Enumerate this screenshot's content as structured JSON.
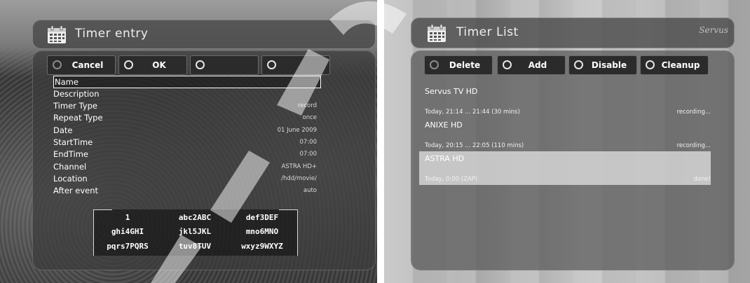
{
  "timer_entry": {
    "title": "Timer entry",
    "buttons": [
      {
        "label": "Cancel"
      },
      {
        "label": "OK"
      },
      {
        "label": ""
      },
      {
        "label": ""
      }
    ],
    "fields": [
      {
        "label": "Name",
        "value": ""
      },
      {
        "label": "Description",
        "value": ""
      },
      {
        "label": "Timer Type",
        "value": "record"
      },
      {
        "label": "Repeat Type",
        "value": "once"
      },
      {
        "label": "Date",
        "value": "01 June 2009"
      },
      {
        "label": "StartTime",
        "value": "07:00"
      },
      {
        "label": "EndTime",
        "value": "07:00"
      },
      {
        "label": "Channel",
        "value": "ASTRA HD+"
      },
      {
        "label": "Location",
        "value": "/hdd/movie/"
      },
      {
        "label": "After event",
        "value": "auto"
      }
    ],
    "keypad": [
      [
        "1",
        "abc2ABC",
        "def3DEF"
      ],
      [
        "ghi4GHI",
        "jkl5JKL",
        "mno6MNO"
      ],
      [
        "pqrs7PQRS",
        "tuv8TUV",
        "wxyz9WXYZ"
      ]
    ]
  },
  "timer_list": {
    "title": "Timer List",
    "buttons": [
      {
        "label": "Delete"
      },
      {
        "label": "Add"
      },
      {
        "label": "Disable"
      },
      {
        "label": "Cleanup"
      }
    ],
    "entries": [
      {
        "channel": "Servus TV HD",
        "time": "Today, 21:14 ... 21:44 (30 mins)",
        "status": "recording..."
      },
      {
        "channel": "ANIXE HD",
        "time": "Today, 20:15 ... 22:05 (110 mins)",
        "status": "recording..."
      },
      {
        "channel": "ASTRA HD",
        "time": "Today, 0:00 (ZAP)",
        "status": "done!"
      }
    ],
    "logo": "Servus"
  },
  "icons": {
    "title_icon": "calendar-icon",
    "button_indicator": "ring-indicator-icon"
  },
  "colors": {
    "panel_bg": "#3c3c3c",
    "selected_row_bg": "#dedede",
    "text": "#ffffff"
  }
}
